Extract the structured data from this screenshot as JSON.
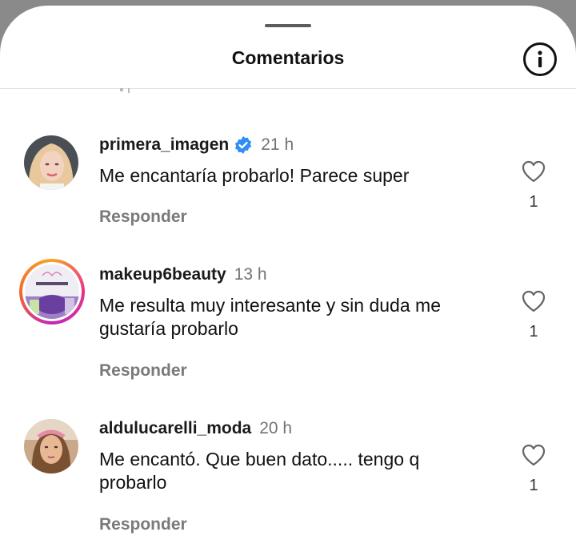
{
  "header": {
    "title": "Comentarios"
  },
  "comments": [
    {
      "username": "primera_imagen",
      "verified": true,
      "time": "21 h",
      "text": "Me encantaría probarlo! Parece super",
      "reply_label": "Responder",
      "likes": "1",
      "avatar_icon": "profile-photo"
    },
    {
      "username": "makeup6beauty",
      "verified": false,
      "time": "13 h",
      "text": "Me resulta muy interesante y sin duda me gustaría probarlo",
      "reply_label": "Responder",
      "likes": "1",
      "avatar_icon": "story-ring-profile-photo"
    },
    {
      "username": "aldulucarelli_moda",
      "verified": false,
      "time": "20 h",
      "text": "Me encantó. Que buen dato..... tengo q probarlo",
      "reply_label": "Responder",
      "likes": "1",
      "avatar_icon": "profile-photo"
    }
  ],
  "colors": {
    "verified_badge": "#2f8ef4",
    "story_ring": "#e9318b",
    "muted_text": "#737373"
  },
  "icons": {
    "info": "info-icon",
    "like": "heart-outline-icon",
    "verified": "verified-badge-icon"
  }
}
